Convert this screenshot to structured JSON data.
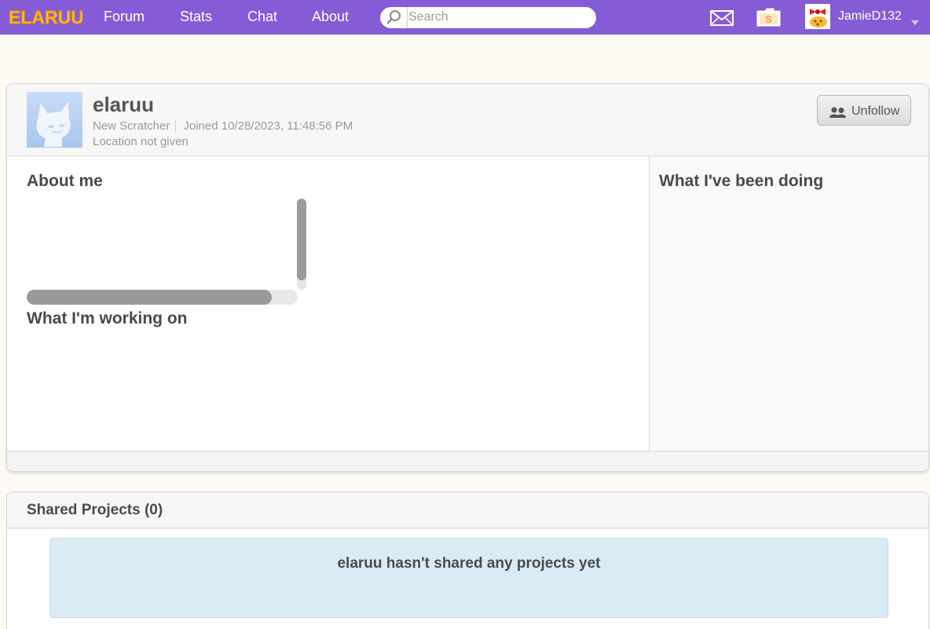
{
  "brand": {
    "logo_text": "ELARUU",
    "accent": "#855cd6"
  },
  "nav": {
    "links": [
      {
        "label": "Forum"
      },
      {
        "label": "Stats"
      },
      {
        "label": "Chat"
      },
      {
        "label": "About"
      }
    ],
    "search": {
      "placeholder": "Search",
      "icon": "search-icon"
    },
    "messages_icon": "envelope-icon",
    "mystuff_icon": "folder-icon",
    "user": {
      "name": "JamieD132",
      "menu_icon": "chevron-down-icon"
    }
  },
  "profile": {
    "username": "elaruu",
    "rank": "New Scratcher",
    "joined": "Joined 10/28/2023, 11:48:56 PM",
    "location": "Location not given",
    "unfollow_label": "Unfollow",
    "about_heading": "About me",
    "working_heading": "What I'm working on",
    "doing_heading": "What I've been doing"
  },
  "shared": {
    "title": "Shared Projects (0)",
    "empty_message": "elaruu hasn't shared any projects yet"
  }
}
